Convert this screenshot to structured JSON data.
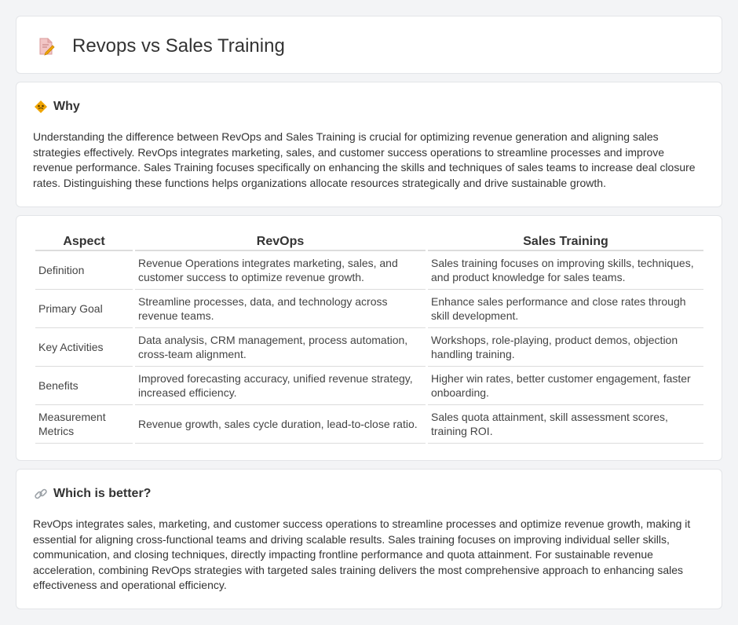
{
  "header": {
    "title": "Revops vs Sales Training",
    "icon": "document-pencil-icon"
  },
  "why": {
    "title": "Why",
    "icon": "diamond-warning-icon",
    "text": "Understanding the difference between RevOps and Sales Training is crucial for optimizing revenue generation and aligning sales strategies effectively. RevOps integrates marketing, sales, and customer success operations to streamline processes and improve revenue performance. Sales Training focuses specifically on enhancing the skills and techniques of sales teams to increase deal closure rates. Distinguishing these functions helps organizations allocate resources strategically and drive sustainable growth."
  },
  "table": {
    "headers": [
      "Aspect",
      "RevOps",
      "Sales Training"
    ],
    "rows": [
      [
        "Definition",
        "Revenue Operations integrates marketing, sales, and customer success to optimize revenue growth.",
        "Sales training focuses on improving skills, techniques, and product knowledge for sales teams."
      ],
      [
        "Primary Goal",
        "Streamline processes, data, and technology across revenue teams.",
        "Enhance sales performance and close rates through skill development."
      ],
      [
        "Key Activities",
        "Data analysis, CRM management, process automation, cross-team alignment.",
        "Workshops, role-playing, product demos, objection handling training."
      ],
      [
        "Benefits",
        "Improved forecasting accuracy, unified revenue strategy, increased efficiency.",
        "Higher win rates, better customer engagement, faster onboarding."
      ],
      [
        "Measurement Metrics",
        "Revenue growth, sales cycle duration, lead-to-close ratio.",
        "Sales quota attainment, skill assessment scores, training ROI."
      ]
    ]
  },
  "better": {
    "title": "Which is better?",
    "icon": "link-icon",
    "text": "RevOps integrates sales, marketing, and customer success operations to streamline processes and optimize revenue growth, making it essential for aligning cross-functional teams and driving scalable results. Sales training focuses on improving individual seller skills, communication, and closing techniques, directly impacting frontline performance and quota attainment. For sustainable revenue acceleration, combining RevOps strategies with targeted sales training delivers the most comprehensive approach to enhancing sales effectiveness and operational efficiency."
  },
  "colors": {
    "accent": "#f0a500",
    "link_icon": "#9aa0a6",
    "icon_pink": "#e7a0a0"
  }
}
